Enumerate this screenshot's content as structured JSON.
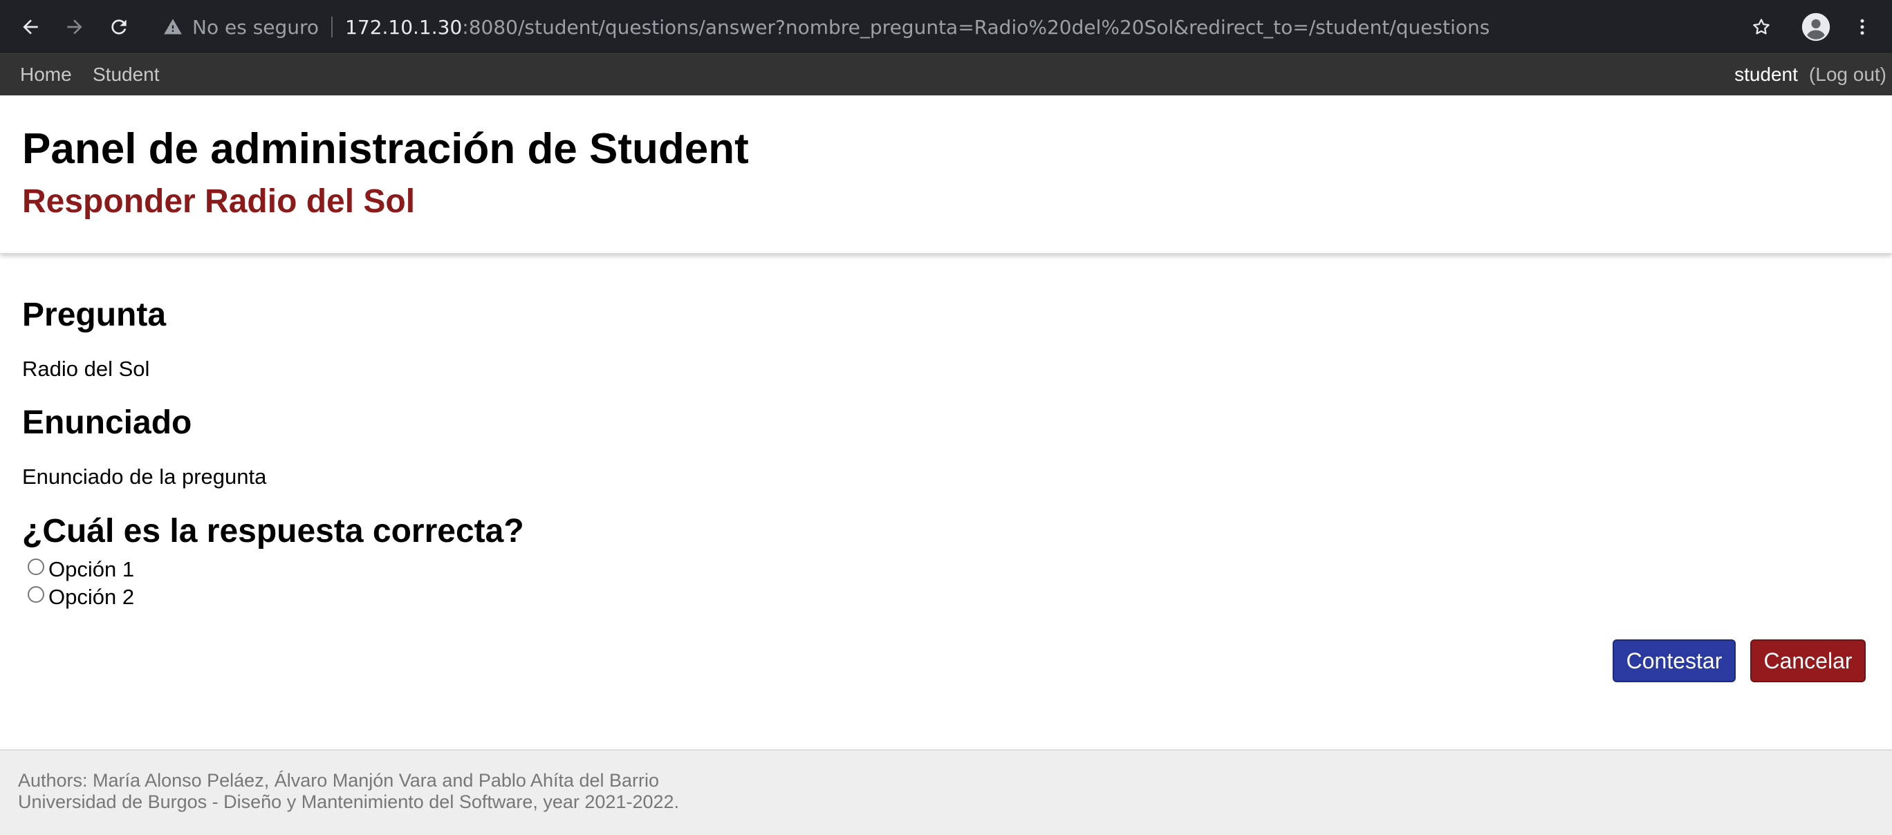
{
  "browser": {
    "security_label": "No es seguro",
    "url_host": "172.10.1.30",
    "url_rest": ":8080/student/questions/answer?nombre_pregunta=Radio%20del%20Sol&redirect_to=/student/questions",
    "icons": [
      "back-arrow-icon",
      "forward-arrow-icon",
      "reload-icon",
      "warning-icon",
      "star-icon",
      "profile-icon",
      "kebab-menu-icon"
    ]
  },
  "site_nav": {
    "home": "Home",
    "student": "Student",
    "username": "student",
    "logout": "(Log out)"
  },
  "header": {
    "title": "Panel de administración de Student",
    "subtitle": "Responder Radio del Sol"
  },
  "content": {
    "question_heading": "Pregunta",
    "question_name": "Radio del Sol",
    "statement_heading": "Enunciado",
    "statement_text": "Enunciado de la pregunta",
    "answer_heading": "¿Cuál es la respuesta correcta?",
    "options": [
      "Opción 1",
      "Opción 2"
    ]
  },
  "actions": {
    "submit": "Contestar",
    "cancel": "Cancelar"
  },
  "footer": {
    "authors": "Authors: María Alonso Peláez, Álvaro Manjón Vara and Pablo Ahíta del Barrio",
    "institution": "Universidad de Burgos - Diseño y Mantenimiento del Software, year 2021-2022."
  },
  "colors": {
    "subtitle": "#8b1a1a",
    "submit_button": "#2b3aa0",
    "cancel_button": "#951a1d",
    "nav_background": "#333333"
  }
}
